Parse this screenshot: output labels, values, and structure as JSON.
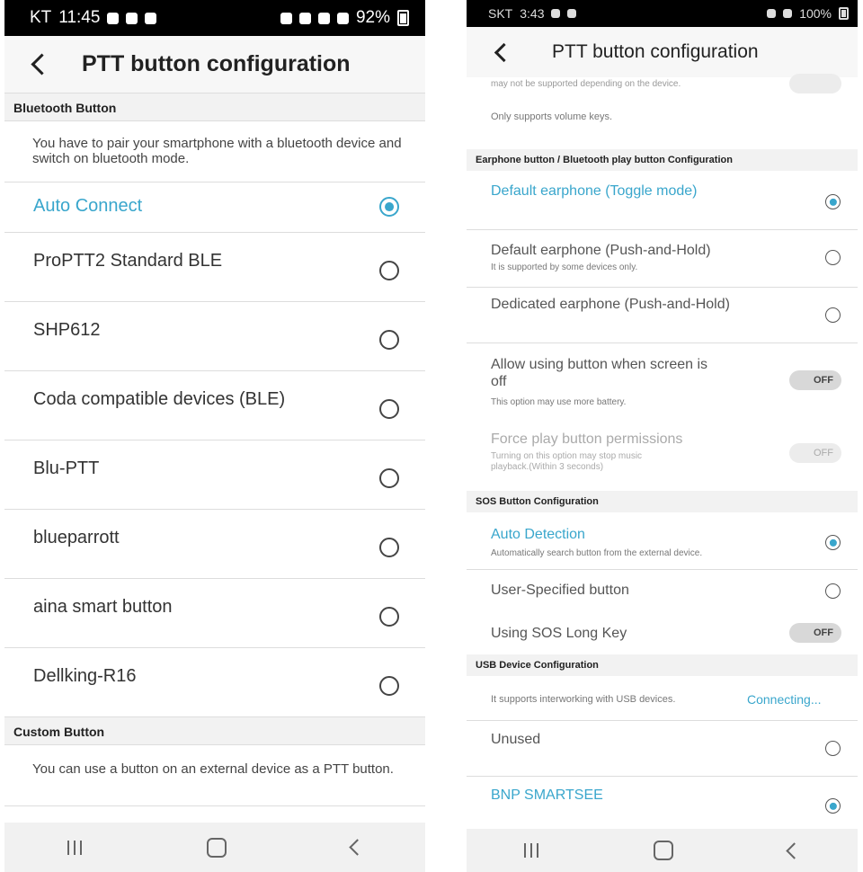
{
  "left_phone": {
    "status": {
      "carrier": "KT",
      "time": "11:45",
      "battery": "92%"
    },
    "title": "PTT button configuration",
    "sections": {
      "bluetooth": "Bluetooth Button",
      "bluetooth_desc": "You have to pair your smartphone with a bluetooth device and switch on bluetooth mode.",
      "custom": "Custom Button",
      "custom_desc": "You can use a button on an external device as a PTT button."
    },
    "devices": [
      {
        "label": "Auto Connect",
        "selected": true
      },
      {
        "label": "ProPTT2 Standard BLE",
        "selected": false
      },
      {
        "label": "SHP612",
        "selected": false
      },
      {
        "label": "Coda compatible devices (BLE)",
        "selected": false
      },
      {
        "label": "Blu-PTT",
        "selected": false
      },
      {
        "label": "blueparrott",
        "selected": false
      },
      {
        "label": "aina smart button",
        "selected": false
      },
      {
        "label": "Dellking-R16",
        "selected": false
      }
    ]
  },
  "right_phone": {
    "status": {
      "carrier": "SKT",
      "time": "3:43",
      "battery": "100%"
    },
    "title": "PTT button configuration",
    "top_partial": "may not be supported depending on the device.",
    "top_line2": "Only supports volume keys.",
    "sections": {
      "earphone": "Earphone button / Bluetooth play button Configuration",
      "sos": "SOS Button Configuration",
      "usb": "USB Device Configuration"
    },
    "earphone_items": [
      {
        "label": "Default earphone (Toggle mode)",
        "sub": "",
        "selected": true
      },
      {
        "label": "Default earphone (Push-and-Hold)",
        "sub": "It is supported by some devices only.",
        "selected": false
      },
      {
        "label": "Dedicated earphone (Push-and-Hold)",
        "sub": "",
        "selected": false
      }
    ],
    "screen_off": {
      "label_line1": "Allow using button when screen is",
      "label_line2": "off",
      "sub": "This option may use more battery.",
      "toggle": "OFF"
    },
    "force_play": {
      "label": "Force play button permissions",
      "sub_line1": "Turning on this option may stop music",
      "sub_line2": "playback.(Within 3 seconds)",
      "toggle": "OFF"
    },
    "sos_items": {
      "auto_label": "Auto Detection",
      "auto_sub": "Automatically search button from the external device.",
      "user_label": "User-Specified button",
      "long_key_label": "Using SOS Long Key",
      "long_key_toggle": "OFF"
    },
    "usb": {
      "desc": "It supports interworking with USB devices.",
      "status": "Connecting...",
      "items": [
        {
          "label": "Unused",
          "selected": false
        },
        {
          "label": "BNP SMARTSEE",
          "selected": true
        }
      ]
    }
  },
  "colors": {
    "accent": "#39a6cc",
    "statusbar": "#000000",
    "section_bg": "#f2f2f2"
  }
}
